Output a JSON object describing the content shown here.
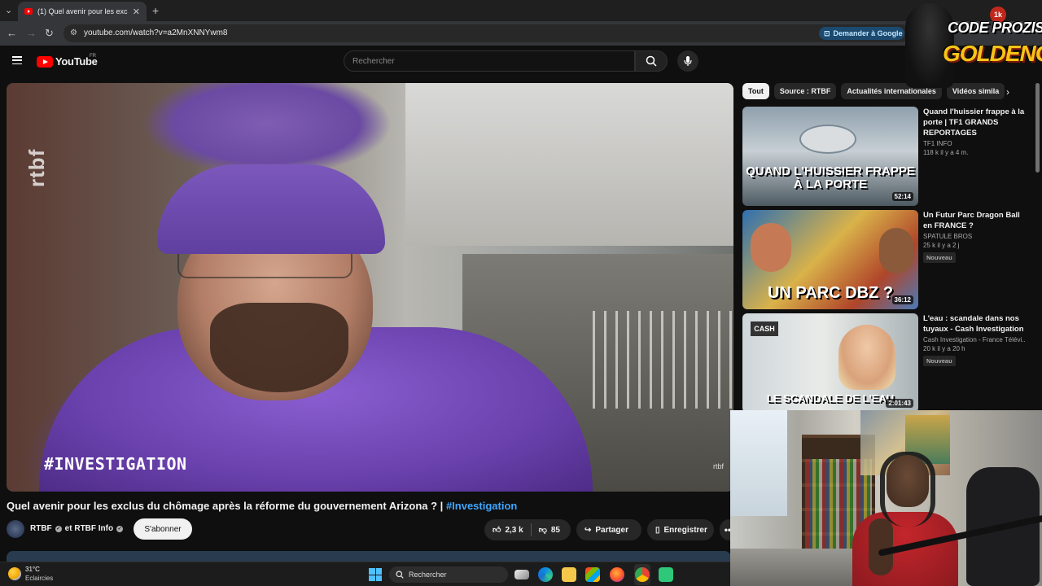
{
  "browser": {
    "tab_title": "(1) Quel avenir pour les exclus du chômage",
    "url": "youtube.com/watch?v=a2MnXNNYwm8",
    "ask_google_label": "Demander à Google"
  },
  "youtube": {
    "logo_text": "YouTube",
    "country": "FR",
    "search_placeholder": "Rechercher"
  },
  "video": {
    "watermark_rtbf": "rtbf",
    "watermark_investigation": "#INVESTIGATION",
    "title": "Quel avenir pour les exclus du chômage après la réforme du gouvernement Arizona ? |",
    "title_tag": "#Investigation",
    "channel": "RTBF",
    "channel_collab": "et RTBF Info",
    "subscribe_label": "S'abonner",
    "likes": "2,3 k",
    "dislikes": "85",
    "share_label": "Partager",
    "save_label": "Enregistrer"
  },
  "chips": [
    "Tout",
    "Source : RTBF",
    "Actualités internationales",
    "Vidéos simila"
  ],
  "recommendations": [
    {
      "title": "Quand l'huissier frappe à la porte | TF1 GRANDS REPORTAGES",
      "channel": "TF1 INFO",
      "meta": "118 k   il y a 4 m.",
      "duration": "52:14",
      "thumb_text": "QUAND L'HUISSIER FRAPPE À LA PORTE",
      "badge": ""
    },
    {
      "title": "Un Futur Parc Dragon Ball en FRANCE ?",
      "channel": "SPATULE BROS",
      "meta": "25 k   il y a 2 j",
      "duration": "36:12",
      "thumb_text": "UN PARC DBZ ?",
      "badge": "Nouveau"
    },
    {
      "title": "L'eau : scandale dans nos tuyaux - Cash Investigation",
      "channel": "Cash Investigation - France Télévi...",
      "meta": "20 k   il y a 20 h",
      "duration": "2:01:43",
      "thumb_text": "LE SCANDALE DE L'EAU",
      "badge": "Nouveau"
    }
  ],
  "overlay": {
    "line1": "CODE PROZIS",
    "line2": "GOLDENG",
    "badge": "1k"
  },
  "taskbar": {
    "temperature": "31°C",
    "weather": "Eclaircies",
    "search_label": "Rechercher"
  },
  "colors": {
    "background": "#0f0f0f",
    "accent_link": "#3ea6ff",
    "youtube_red": "#ff0000"
  }
}
